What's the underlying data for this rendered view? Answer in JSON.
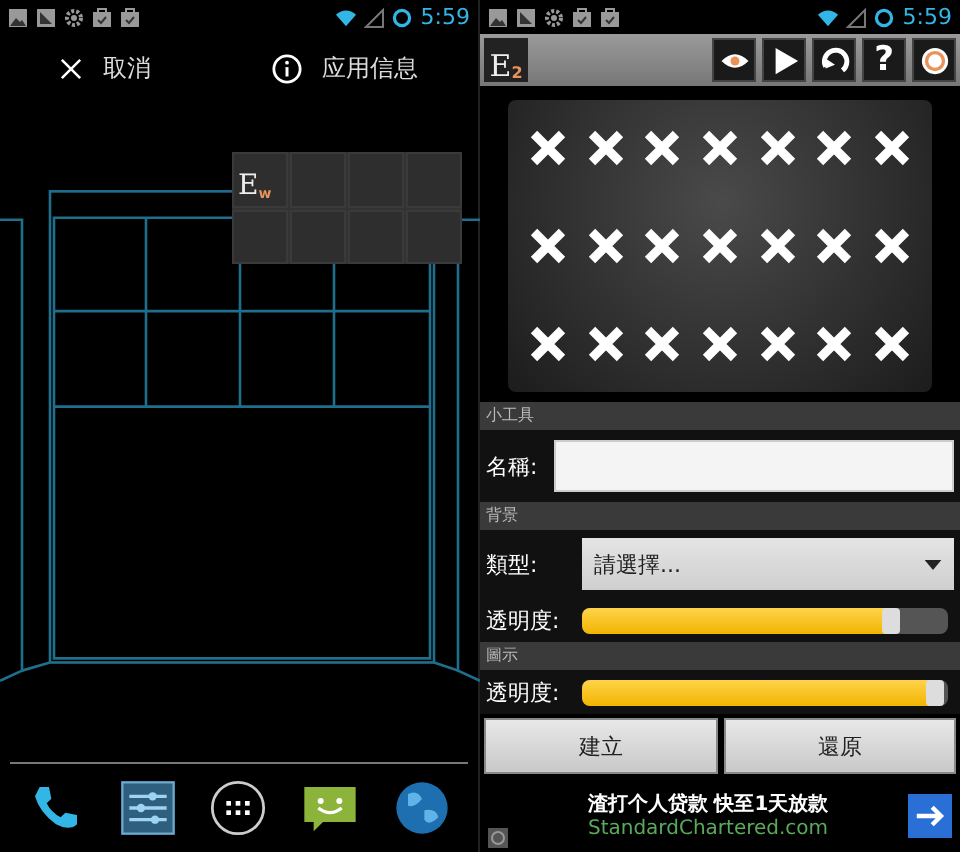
{
  "left_screen": {
    "status_bar": {
      "time": "5:59"
    },
    "action_bar": {
      "cancel": "取消",
      "app_info": "应用信息"
    },
    "widget_preview": {
      "logo": "E",
      "logo_sub": "w"
    }
  },
  "right_screen": {
    "status_bar": {
      "time": "5:59"
    },
    "toolbar": {
      "logo": "E",
      "logo_sub": "2",
      "buttons": [
        {
          "kind": "eye"
        },
        {
          "kind": "play"
        },
        {
          "kind": "refresh"
        },
        {
          "kind": "help",
          "label": "?"
        },
        {
          "kind": "power"
        }
      ]
    },
    "sections": [
      {
        "header": "小工具",
        "rows": [
          {
            "kind": "text",
            "label": "名稱:",
            "value": ""
          }
        ]
      },
      {
        "header": "背景",
        "rows": [
          {
            "kind": "select",
            "label": "類型:",
            "placeholder": "請選擇..."
          },
          {
            "kind": "slider",
            "label": "透明度:",
            "level": 0.86
          }
        ]
      },
      {
        "header": "圖示",
        "rows": [
          {
            "kind": "slider",
            "label": "透明度:",
            "level": 0.99
          }
        ]
      }
    ],
    "buttons": [
      "建立",
      "還原"
    ],
    "ad": {
      "headline": "渣打个人贷款 快至1天放款",
      "url": "StandardChartered.com"
    }
  }
}
